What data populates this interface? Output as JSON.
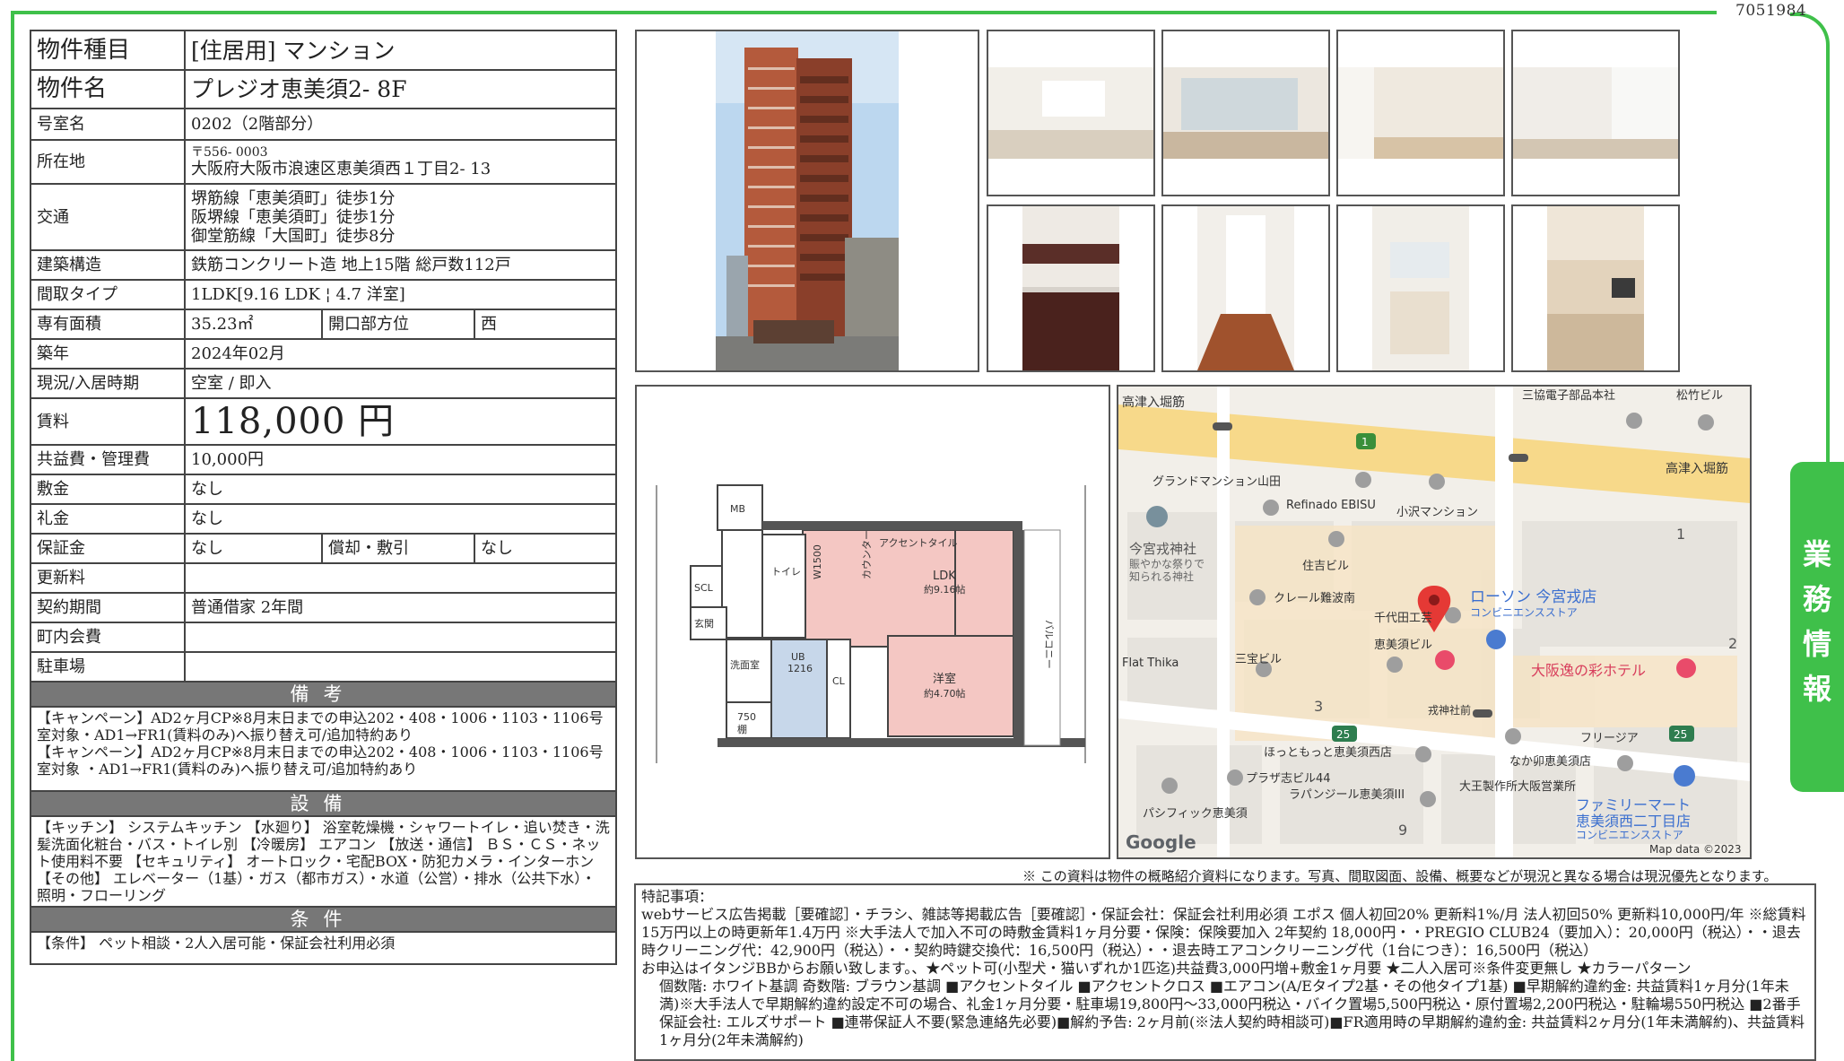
{
  "property_id": "7051984",
  "fields": {
    "type_label": "物件種目",
    "type_value": "[住居用]  マンション",
    "name_label": "物件名",
    "name_value": "プレジオ恵美須2- 8F",
    "room_label": "号室名",
    "room_value": "0202（2階部分）",
    "address_label": "所在地",
    "address_postal": "〒556- 0003",
    "address_value": "大阪府大阪市浪速区恵美須西１丁目2- 13",
    "access_label": "交通",
    "access_lines": [
      "堺筋線「恵美須町」徒歩1分",
      "阪堺線「恵美須町」徒歩1分",
      "御堂筋線「大国町」徒歩8分"
    ],
    "structure_label": "建築構造",
    "structure_value": "鉄筋コンクリート造  地上15階  総戸数112戸",
    "layout_label": "間取タイプ",
    "layout_value": "1LDK[9.16  LDK ¦  4.7 洋室]",
    "area_label": "専有面積",
    "area_value": "35.23㎡",
    "direction_label": "開口部方位",
    "direction_value": "西",
    "built_label": "築年",
    "built_value": "2024年02月",
    "status_label": "現況/入居時期",
    "status_value": "空室  /  即入",
    "rent_label": "賃料",
    "rent_value": "118,000  円",
    "fee_label": "共益費・管理費",
    "fee_value": "10,000円",
    "deposit_label": "敷金",
    "deposit_value": "なし",
    "key_money_label": "礼金",
    "key_money_value": "なし",
    "guarantee_label": "保証金",
    "guarantee_value": "なし",
    "amort_label": "償却・敷引",
    "amort_value": "なし",
    "renewal_label": "更新料",
    "renewal_value": "",
    "contract_label": "契約期間",
    "contract_value": "普通借家  2年間",
    "community_label": "町内会費",
    "community_value": "",
    "parking_label": "駐車場",
    "parking_value": ""
  },
  "sections": {
    "remarks_title": "備考",
    "remarks_lines": [
      "【キャンペーン】AD2ヶ月CP※8月末日までの申込202・408・1006・1103・1106号室対象・AD1→FR1(賃料のみ)へ振り替え可/追加特約あり",
      "【キャンペーン】AD2ヶ月CP※8月末日までの申込202・408・1006・1103・1106号室対象  ・AD1→FR1(賃料のみ)へ振り替え可/追加特約あり"
    ],
    "equipment_title": "設備",
    "equipment_text": "【キッチン】  システムキッチン  【水廻り】  浴室乾燥機・シャワートイレ・追い焚き・洗髪洗面化粧台・バス・トイレ別  【冷暖房】  エアコン  【放送・通信】  ＢＳ・ＣＳ・ネット使用料不要  【セキュリティ】  オートロック・宅配BOX・防犯カメラ・インターホン  【その他】  エレベーター（1基）・ガス（都市ガス）・水道（公営）・排水（公共下水）・照明・フローリング",
    "conditions_title": "条件",
    "conditions_text": "【条件】  ペット相談・2人入居可能・保証会社利用必須"
  },
  "floor_plan": {
    "labels": [
      "MB",
      "SCL",
      "玄関",
      "トイレ",
      "洗面室",
      "UB",
      "1216",
      "750",
      "W1500",
      "カウンター",
      "アクセントタイル",
      "LDK",
      "約9.16帖",
      "洋室",
      "約4.70帖",
      "バルコニー",
      "棚",
      "CL"
    ]
  },
  "map": {
    "labels": [
      "高津入堀筋",
      "三協電子部品本社",
      "松竹ビル",
      "高津入堀筋",
      "グランドマンション山田",
      "Refinado EBISU",
      "小沢マンション",
      "今宮戎神社",
      "賑やかな祭りで",
      "知られる神社",
      "住吉ビル",
      "クレール難波南",
      "千代田工芸",
      "ローソン 今宮戎店",
      "コンビニエンスストア",
      "恵美須ビル",
      "Flat Thika",
      "三宝ビル",
      "大阪逸の彩ホテル",
      "戎神社前",
      "フリージア",
      "ほっともっと恵美須西店",
      "なか卯恵美須店",
      "プラザ志ビル44",
      "ラパンジール恵美須III",
      "大王製作所大阪営業所",
      "パシフィック恵美須",
      "ファミリーマート",
      "恵美須西二丁目店",
      "コンビニエンスストア",
      "Google",
      "Map data ©2023"
    ],
    "numbers": [
      "1",
      "1",
      "2",
      "3",
      "25",
      "25",
      "9"
    ]
  },
  "disclaimer": "※  この資料は物件の概略紹介資料になります。写真、間取図面、設備、概要などが現況と異なる場合は現況優先となります。",
  "notes": {
    "title": "特記事項：",
    "lines": [
      "webサービス広告掲載［要確認］・チラシ、雑誌等掲載広告［要確認］・保証会社：保証会社利用必須  エポス  個人初回20%  更新料1%/月     法人初回50%  更新料10,000円/年  ※総賃料15万円以上の時更新年1.4万円  ※大手法人で加入不可の時敷金賃料1ヶ月分要・保険：保険要加入  2年契約  18,000円・・PREGIO CLUB24（要加入）：20,000円（税込）・・退去時クリーニング代：42,900円（税込）・・契約時鍵交換代：16,500円（税込）・・退去時エアコンクリーニング代（1台につき）：16,500円（税込）",
      "お申込はイタンジBBからお願い致します。、★ペット可(小型犬・猫いずれか1匹迄)共益費3,000円増+敷金1ヶ月要  ★二人入居可※条件変更無し  ★カラーパターン",
      "個数階: ホワイト基調   奇数階: ブラウン基調   ■アクセントタイル   ■アクセントクロス   ■エアコン(A/Eタイプ2基・その他タイプ1基)   ■早期解約違約金: 共益賃料1ヶ月分(1年未満)※大手法人で早期解約違約設定不可の場合、礼金1ヶ月分要・駐車場19,800円〜33,000円税込・バイク置場5,500円税込・原付置場2,200円税込・駐輪場550円税込   ■2番手保証会社: エルズサポート   ■連帯保証人不要(緊急連絡先必要)■解約予告: 2ヶ月前(※法人契約時相談可)■FR適用時の早期解約違約金: 共益賃料2ヶ月分(1年未満解約)、共益賃料1ヶ月分(2年未満解約)"
    ]
  },
  "side_tab": [
    "業",
    "務",
    "情",
    "報"
  ],
  "colors": {
    "frame_green": "#3fc04a",
    "section_gray": "#777777",
    "map_road_yellow": "#f7d98a",
    "pin_red": "#e53935"
  }
}
